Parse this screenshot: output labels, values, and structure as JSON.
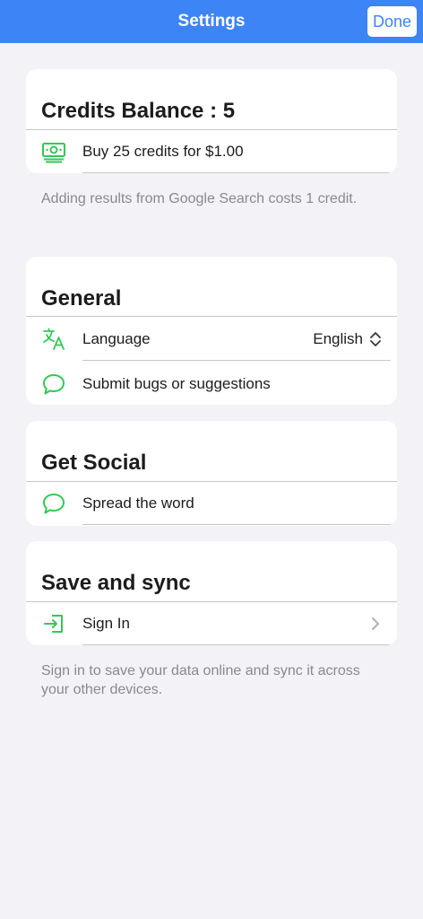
{
  "nav": {
    "title": "Settings",
    "done_label": "Done"
  },
  "credits": {
    "title": "Credits Balance : 5",
    "buy_label": "Buy 25 credits for $1.00",
    "footnote": "Adding results from Google Search costs 1 credit."
  },
  "general": {
    "title": "General",
    "language_label": "Language",
    "language_value": "English",
    "feedback_label": "Submit bugs or suggestions"
  },
  "social": {
    "title": "Get Social",
    "spread_label": "Spread the word"
  },
  "sync": {
    "title": "Save and sync",
    "signin_label": "Sign In",
    "footnote": "Sign in to save your data online and sync it across your other devices."
  },
  "icons": {
    "credits": "money-icon",
    "language": "translate-icon",
    "feedback": "chat-bubble-icon",
    "spread": "chat-bubble-icon",
    "signin": "sign-in-icon",
    "language_chevron": "up-down-chevron-icon",
    "signin_chevron": "chevron-right-icon"
  },
  "colors": {
    "nav_background": "#3d84f7",
    "icon_green": "#34c759",
    "page_background": "#f2f2f7",
    "secondary_text": "#8a8a8e"
  }
}
